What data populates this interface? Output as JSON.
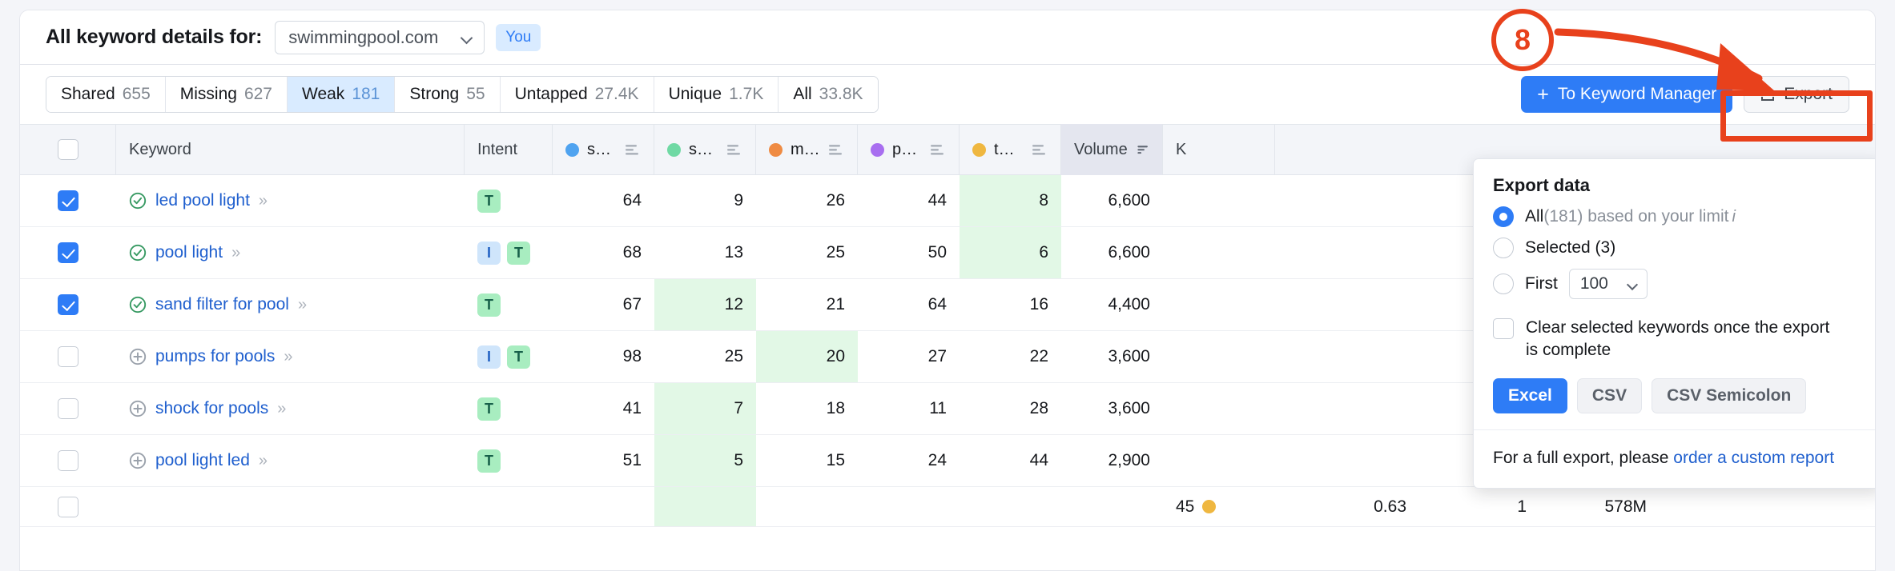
{
  "header": {
    "title": "All keyword details for:",
    "domain_value": "swimmingpool.com",
    "you_badge": "You"
  },
  "filters": [
    {
      "label": "Shared",
      "count": "655",
      "active": false
    },
    {
      "label": "Missing",
      "count": "627",
      "active": false
    },
    {
      "label": "Weak",
      "count": "181",
      "active": true
    },
    {
      "label": "Strong",
      "count": "55",
      "active": false
    },
    {
      "label": "Untapped",
      "count": "27.4K",
      "active": false
    },
    {
      "label": "Unique",
      "count": "1.7K",
      "active": false
    },
    {
      "label": "All",
      "count": "33.8K",
      "active": false
    }
  ],
  "toolbar": {
    "keyword_manager_label": "To Keyword Manager",
    "keyword_manager_plus": "+",
    "export_label": "Export"
  },
  "annotation": {
    "step_number": "8"
  },
  "table": {
    "columns": [
      {
        "key": "select",
        "label": "",
        "dot": "",
        "type": "checkbox"
      },
      {
        "key": "keyword",
        "label": "Keyword",
        "dot": "",
        "type": "text"
      },
      {
        "key": "intent",
        "label": "Intent",
        "dot": "",
        "type": "intent"
      },
      {
        "key": "d1",
        "label": "swimmin...",
        "dot": "#4fa3f0",
        "type": "num"
      },
      {
        "key": "d2",
        "label": "swimuniv...",
        "dot": "#6fd9a4",
        "type": "num"
      },
      {
        "key": "d3",
        "label": "mrpoolm...",
        "dot": "#ef8b43",
        "type": "num"
      },
      {
        "key": "d4",
        "label": "poolrese...",
        "dot": "#a86ef0",
        "type": "num"
      },
      {
        "key": "d5",
        "label": "thepoolf...",
        "dot": "#efb740",
        "type": "num"
      },
      {
        "key": "volume",
        "label": "Volume",
        "dot": "",
        "type": "num"
      },
      {
        "key": "kd",
        "label": "K",
        "dot": "",
        "type": "num"
      }
    ],
    "rows": [
      {
        "checked": true,
        "added": true,
        "keyword": "led pool light",
        "intent": [
          "T"
        ],
        "d1": "64",
        "d2": "9",
        "d3": "26",
        "d4": "44",
        "d5": "8",
        "volume": "6,600",
        "hl": [
          "d5"
        ]
      },
      {
        "checked": true,
        "added": true,
        "keyword": "pool light",
        "intent": [
          "I",
          "T"
        ],
        "d1": "68",
        "d2": "13",
        "d3": "25",
        "d4": "50",
        "d5": "6",
        "volume": "6,600",
        "hl": [
          "d5"
        ]
      },
      {
        "checked": true,
        "added": true,
        "keyword": "sand filter for pool",
        "intent": [
          "T"
        ],
        "d1": "67",
        "d2": "12",
        "d3": "21",
        "d4": "64",
        "d5": "16",
        "volume": "4,400",
        "hl": [
          "d2"
        ]
      },
      {
        "checked": false,
        "added": false,
        "keyword": "pumps for pools",
        "intent": [
          "I",
          "T"
        ],
        "d1": "98",
        "d2": "25",
        "d3": "20",
        "d4": "27",
        "d5": "22",
        "volume": "3,600",
        "hl": [
          "d3"
        ]
      },
      {
        "checked": false,
        "added": false,
        "keyword": "shock for pools",
        "intent": [
          "T"
        ],
        "d1": "41",
        "d2": "7",
        "d3": "18",
        "d4": "11",
        "d5": "28",
        "volume": "3,600",
        "hl": [
          "d2"
        ]
      },
      {
        "checked": false,
        "added": false,
        "keyword": "pool light led",
        "intent": [
          "T"
        ],
        "d1": "51",
        "d2": "5",
        "d3": "15",
        "d4": "24",
        "d5": "44",
        "volume": "2,900",
        "hl": [
          "d2"
        ]
      }
    ],
    "partial_row": {
      "kd": "45",
      "cpc": "0.63",
      "com": "1",
      "results": "578M"
    }
  },
  "export_panel": {
    "title": "Export data",
    "option_all": "All",
    "option_all_count": "(181) based on your limit",
    "info_glyph": "i",
    "option_selected": "Selected (3)",
    "option_first": "First",
    "first_amount": "100",
    "clear_label": "Clear selected keywords once the export is complete",
    "formats": [
      {
        "label": "Excel",
        "primary": true
      },
      {
        "label": "CSV",
        "primary": false
      },
      {
        "label": "CSV Semicolon",
        "primary": false
      }
    ],
    "footer_prefix": "For a full export, please ",
    "footer_link": "order a custom report"
  },
  "colors": {
    "accent": "#2e7cf6",
    "annotation": "#e8411c",
    "highlight": "#e2f8e6",
    "link": "#1f5fce"
  }
}
